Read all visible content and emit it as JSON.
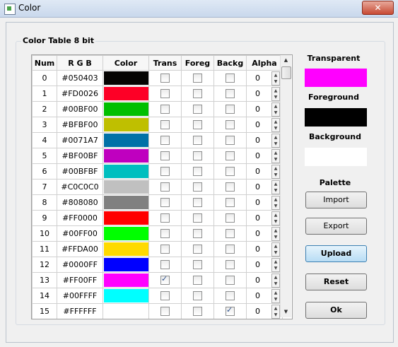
{
  "window": {
    "title": "Color",
    "close_label": "✕"
  },
  "group": {
    "label": "Color Table 8 bit"
  },
  "table": {
    "headers": [
      "Num",
      "R G B",
      "Color",
      "Trans",
      "Foreg",
      "Backg",
      "Alpha"
    ],
    "rows": [
      {
        "num": "0",
        "rgb": "#050403",
        "color": "#050403",
        "trans": false,
        "foreg": false,
        "backg": false,
        "alpha": "0"
      },
      {
        "num": "1",
        "rgb": "#FD0026",
        "color": "#FD0026",
        "trans": false,
        "foreg": false,
        "backg": false,
        "alpha": "0"
      },
      {
        "num": "2",
        "rgb": "#00BF00",
        "color": "#00BF00",
        "trans": false,
        "foreg": false,
        "backg": false,
        "alpha": "0"
      },
      {
        "num": "3",
        "rgb": "#BFBF00",
        "color": "#BFBF00",
        "trans": false,
        "foreg": false,
        "backg": false,
        "alpha": "0"
      },
      {
        "num": "4",
        "rgb": "#0071A7",
        "color": "#0071A7",
        "trans": false,
        "foreg": false,
        "backg": false,
        "alpha": "0"
      },
      {
        "num": "5",
        "rgb": "#BF00BF",
        "color": "#BF00BF",
        "trans": false,
        "foreg": false,
        "backg": false,
        "alpha": "0"
      },
      {
        "num": "6",
        "rgb": "#00BFBF",
        "color": "#00BFBF",
        "trans": false,
        "foreg": false,
        "backg": false,
        "alpha": "0"
      },
      {
        "num": "7",
        "rgb": "#C0C0C0",
        "color": "#C0C0C0",
        "trans": false,
        "foreg": false,
        "backg": false,
        "alpha": "0"
      },
      {
        "num": "8",
        "rgb": "#808080",
        "color": "#808080",
        "trans": false,
        "foreg": false,
        "backg": false,
        "alpha": "0"
      },
      {
        "num": "9",
        "rgb": "#FF0000",
        "color": "#FF0000",
        "trans": false,
        "foreg": false,
        "backg": false,
        "alpha": "0"
      },
      {
        "num": "10",
        "rgb": "#00FF00",
        "color": "#00FF00",
        "trans": false,
        "foreg": false,
        "backg": false,
        "alpha": "0"
      },
      {
        "num": "11",
        "rgb": "#FFDA00",
        "color": "#FFDA00",
        "trans": false,
        "foreg": false,
        "backg": false,
        "alpha": "0"
      },
      {
        "num": "12",
        "rgb": "#0000FF",
        "color": "#0000FF",
        "trans": false,
        "foreg": false,
        "backg": false,
        "alpha": "0"
      },
      {
        "num": "13",
        "rgb": "#FF00FF",
        "color": "#FF00FF",
        "trans": true,
        "foreg": false,
        "backg": false,
        "alpha": "0"
      },
      {
        "num": "14",
        "rgb": "#00FFFF",
        "color": "#00FFFF",
        "trans": false,
        "foreg": false,
        "backg": false,
        "alpha": "0"
      },
      {
        "num": "15",
        "rgb": "#FFFFFF",
        "color": "#FFFFFF",
        "trans": false,
        "foreg": false,
        "backg": true,
        "alpha": "0"
      }
    ]
  },
  "side": {
    "transparent_label": "Transparent",
    "transparent_color": "#FF00FF",
    "foreground_label": "Foreground",
    "foreground_color": "#000000",
    "background_label": "Background",
    "background_color": "#FFFFFF",
    "palette_label": "Palette",
    "import_label": "Import",
    "export_label": "Export",
    "upload_label": "Upload",
    "reset_label": "Reset",
    "ok_label": "Ok"
  }
}
